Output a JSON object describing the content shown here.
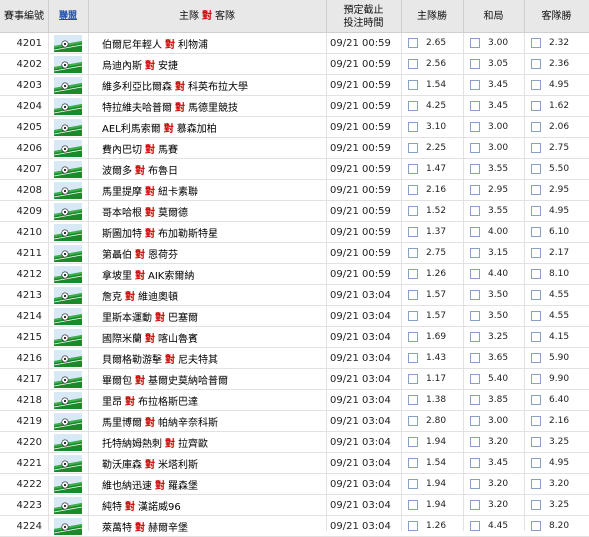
{
  "header": {
    "id": "賽事編號",
    "league": "聯盟",
    "home": "主隊",
    "vs": "對",
    "away": "客隊",
    "deadline_line1": "預定截止",
    "deadline_line2": "投注時間",
    "home_win": "主隊勝",
    "draw": "和局",
    "away_win": "客隊勝"
  },
  "colors": {
    "vs_red": "#d00000",
    "league_blue": "#1f4fa8",
    "header_bg": "#e8e8e8"
  },
  "league_icon": "soccer-pitch-icon",
  "matches": [
    {
      "id": "4201",
      "home": "伯爾尼年輕人",
      "vs": "對",
      "away": "利物浦",
      "time": "09/21 00:59",
      "h": "2.65",
      "d": "3.00",
      "a": "2.32"
    },
    {
      "id": "4202",
      "home": "烏迪內斯",
      "vs": "對",
      "away": "安捷",
      "time": "09/21 00:59",
      "h": "2.56",
      "d": "3.05",
      "a": "2.36"
    },
    {
      "id": "4203",
      "home": "維多利亞比爾森",
      "vs": "對",
      "away": "科英布拉大學",
      "time": "09/21 00:59",
      "h": "1.54",
      "d": "3.45",
      "a": "4.95"
    },
    {
      "id": "4204",
      "home": "特拉維夫哈普爾",
      "vs": "對",
      "away": "馬德里競技",
      "time": "09/21 00:59",
      "h": "4.25",
      "d": "3.45",
      "a": "1.62"
    },
    {
      "id": "4205",
      "home": "AEL利馬索爾",
      "vs": "對",
      "away": "慕森加柏",
      "time": "09/21 00:59",
      "h": "3.10",
      "d": "3.00",
      "a": "2.06"
    },
    {
      "id": "4206",
      "home": "費內巴切",
      "vs": "對",
      "away": "馬賽",
      "time": "09/21 00:59",
      "h": "2.25",
      "d": "3.00",
      "a": "2.75"
    },
    {
      "id": "4207",
      "home": "波爾多",
      "vs": "對",
      "away": "布魯日",
      "time": "09/21 00:59",
      "h": "1.47",
      "d": "3.55",
      "a": "5.50"
    },
    {
      "id": "4208",
      "home": "馬里提摩",
      "vs": "對",
      "away": "紐卡素聯",
      "time": "09/21 00:59",
      "h": "2.16",
      "d": "2.95",
      "a": "2.95"
    },
    {
      "id": "4209",
      "home": "哥本哈根",
      "vs": "對",
      "away": "莫爾德",
      "time": "09/21 00:59",
      "h": "1.52",
      "d": "3.55",
      "a": "4.95"
    },
    {
      "id": "4210",
      "home": "斯圖加特",
      "vs": "對",
      "away": "布加勒斯特星",
      "time": "09/21 00:59",
      "h": "1.37",
      "d": "4.00",
      "a": "6.10"
    },
    {
      "id": "4211",
      "home": "第聶伯",
      "vs": "對",
      "away": "恩荷芬",
      "time": "09/21 00:59",
      "h": "2.75",
      "d": "3.15",
      "a": "2.17"
    },
    {
      "id": "4212",
      "home": "拿坡里",
      "vs": "對",
      "away": "AIK索爾納",
      "time": "09/21 00:59",
      "h": "1.26",
      "d": "4.40",
      "a": "8.10"
    },
    {
      "id": "4213",
      "home": "詹克",
      "vs": "對",
      "away": "維迪奧頓",
      "time": "09/21 03:04",
      "h": "1.57",
      "d": "3.50",
      "a": "4.55"
    },
    {
      "id": "4214",
      "home": "里斯本運動",
      "vs": "對",
      "away": "巴塞爾",
      "time": "09/21 03:04",
      "h": "1.57",
      "d": "3.50",
      "a": "4.55"
    },
    {
      "id": "4215",
      "home": "國際米蘭",
      "vs": "對",
      "away": "喀山魯賓",
      "time": "09/21 03:04",
      "h": "1.69",
      "d": "3.25",
      "a": "4.15"
    },
    {
      "id": "4216",
      "home": "貝爾格勒游擊",
      "vs": "對",
      "away": "尼夫特其",
      "time": "09/21 03:04",
      "h": "1.43",
      "d": "3.65",
      "a": "5.90"
    },
    {
      "id": "4217",
      "home": "畢爾包",
      "vs": "對",
      "away": "基爾史莫納哈普爾",
      "time": "09/21 03:04",
      "h": "1.17",
      "d": "5.40",
      "a": "9.90"
    },
    {
      "id": "4218",
      "home": "里昂",
      "vs": "對",
      "away": "布拉格斯巴達",
      "time": "09/21 03:04",
      "h": "1.38",
      "d": "3.85",
      "a": "6.40"
    },
    {
      "id": "4219",
      "home": "馬里博爾",
      "vs": "對",
      "away": "帕納辛奈科斯",
      "time": "09/21 03:04",
      "h": "2.80",
      "d": "3.00",
      "a": "2.16"
    },
    {
      "id": "4220",
      "home": "托特納姆熱刺",
      "vs": "對",
      "away": "拉齊歐",
      "time": "09/21 03:04",
      "h": "1.94",
      "d": "3.20",
      "a": "3.25"
    },
    {
      "id": "4221",
      "home": "勒沃庫森",
      "vs": "對",
      "away": "米塔利斯",
      "time": "09/21 03:04",
      "h": "1.54",
      "d": "3.45",
      "a": "4.95"
    },
    {
      "id": "4222",
      "home": "維也納迅速",
      "vs": "對",
      "away": "羅森堡",
      "time": "09/21 03:04",
      "h": "1.94",
      "d": "3.20",
      "a": "3.20"
    },
    {
      "id": "4223",
      "home": "純特",
      "vs": "對",
      "away": "漢諾威96",
      "time": "09/21 03:04",
      "h": "1.94",
      "d": "3.20",
      "a": "3.25"
    },
    {
      "id": "4224",
      "home": "萊萬特",
      "vs": "對",
      "away": "赫爾辛堡",
      "time": "09/21 03:04",
      "h": "1.26",
      "d": "4.45",
      "a": "8.20"
    }
  ]
}
